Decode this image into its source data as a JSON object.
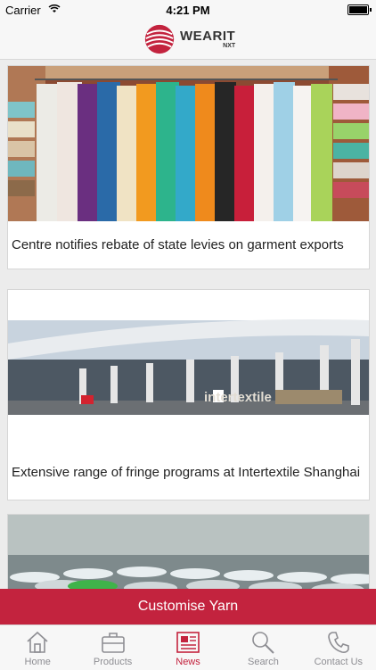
{
  "status_bar": {
    "carrier": "Carrier",
    "time": "4:21 PM"
  },
  "header": {
    "logo_brand": "WEARIT",
    "logo_sub": "NXT",
    "accent": "#c3233e"
  },
  "news": [
    {
      "title": "Centre notifies rebate of state levies on garment exports"
    },
    {
      "title": "Extensive range of fringe programs at Intertextile Shanghai",
      "image_text": "intertextile"
    },
    {
      "title": ""
    }
  ],
  "cta": {
    "label": "Customise Yarn"
  },
  "tabs": [
    {
      "label": "Home",
      "icon": "home-icon",
      "active": false
    },
    {
      "label": "Products",
      "icon": "briefcase-icon",
      "active": false
    },
    {
      "label": "News",
      "icon": "newspaper-icon",
      "active": true
    },
    {
      "label": "Search",
      "icon": "search-icon",
      "active": false
    },
    {
      "label": "Contact Us",
      "icon": "phone-icon",
      "active": false
    }
  ]
}
